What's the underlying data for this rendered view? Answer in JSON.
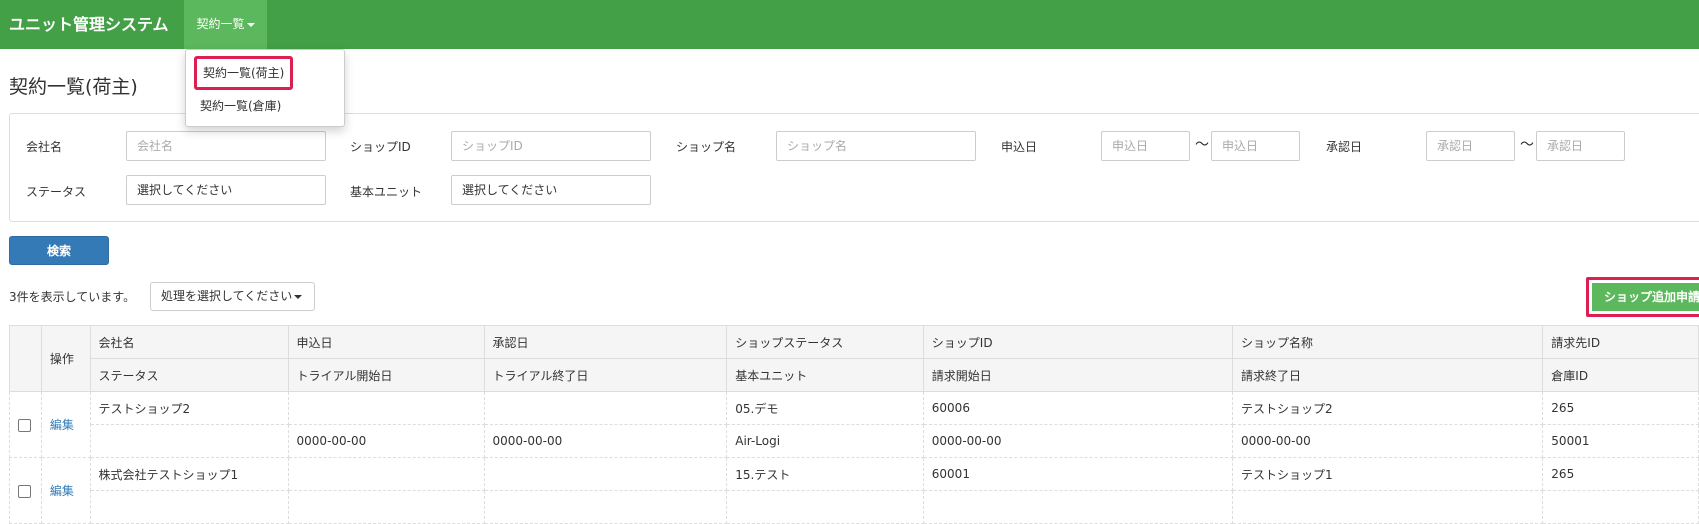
{
  "app": {
    "title": "ユニット管理システム"
  },
  "nav": {
    "menu_label": "契約一覧",
    "dropdown": [
      "契約一覧(荷主)",
      "契約一覧(倉庫)"
    ]
  },
  "page": {
    "title": "契約一覧(荷主)"
  },
  "search": {
    "company_label": "会社名",
    "company_placeholder": "会社名",
    "shop_id_label": "ショップID",
    "shop_id_placeholder": "ショップID",
    "shop_name_label": "ショップ名",
    "shop_name_placeholder": "ショップ名",
    "apply_date_label": "申込日",
    "apply_from_placeholder": "申込日",
    "apply_to_placeholder": "申込日",
    "approve_date_label": "承認日",
    "approve_from_placeholder": "承認日",
    "approve_to_placeholder": "承認日",
    "tilde": "～",
    "status_label": "ステータス",
    "status_value": "選択してください",
    "unit_label": "基本ユニット",
    "unit_value": "選択してください",
    "search_button": "検索"
  },
  "results": {
    "count_text": "3件を表示しています。",
    "action_select": "処理を選択してください",
    "add_shop_button": "ショップ追加申請"
  },
  "table": {
    "header_row1": [
      "会社名",
      "申込日",
      "承認日",
      "ショップステータス",
      "ショップID",
      "ショップ名称",
      "請求先ID"
    ],
    "header_row2": [
      "ステータス",
      "トライアル開始日",
      "トライアル終了日",
      "基本ユニット",
      "請求開始日",
      "請求終了日",
      "倉庫ID"
    ],
    "operation_header": "操作",
    "rows": [
      {
        "edit": "編集",
        "line1": [
          "テストショップ2",
          "",
          "",
          "05.デモ",
          "60006",
          "テストショップ2",
          "265"
        ],
        "line2": [
          "",
          "0000-00-00",
          "0000-00-00",
          "Air-Logi",
          "0000-00-00",
          "0000-00-00",
          "50001"
        ]
      },
      {
        "edit": "編集",
        "line1": [
          "株式会社テストショップ1",
          "",
          "",
          "15.テスト",
          "60001",
          "テストショップ1",
          "265"
        ],
        "line2": [
          "",
          "",
          "",
          "",
          "",
          "",
          ""
        ]
      }
    ]
  },
  "colors": {
    "navbar": "#43a047",
    "primary": "#337ab7",
    "success": "#5cb85c",
    "highlight": "#dc1f50"
  }
}
